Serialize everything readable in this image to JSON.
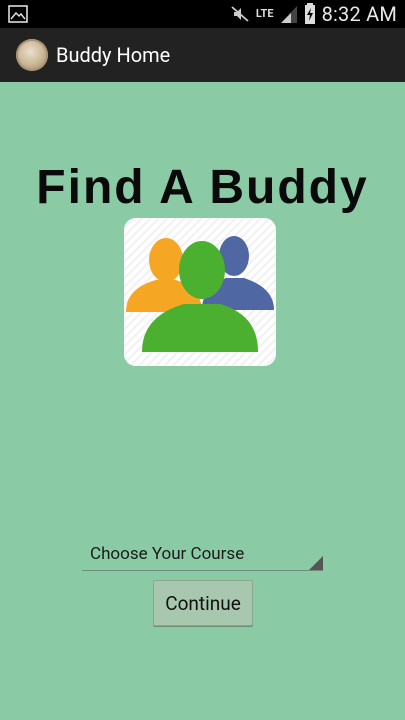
{
  "status_bar": {
    "time": "8:32 AM",
    "network": "LTE",
    "icons": [
      "image-icon",
      "mute-icon",
      "lte-icon",
      "signal-icon",
      "battery-charging-icon"
    ]
  },
  "action_bar": {
    "title": "Buddy Home",
    "icon": "app-avatar-icon"
  },
  "main": {
    "headline": "Find A Buddy",
    "logo": "buddy-group-logo",
    "course_spinner": {
      "selected": "Choose Your Course"
    },
    "continue_label": "Continue"
  },
  "colors": {
    "background": "#8ACBA6",
    "action_bar": "#222222",
    "status_bar": "#000000",
    "person_orange": "#F5A623",
    "person_green": "#4BAF2F",
    "person_blue": "#4F67A3"
  }
}
